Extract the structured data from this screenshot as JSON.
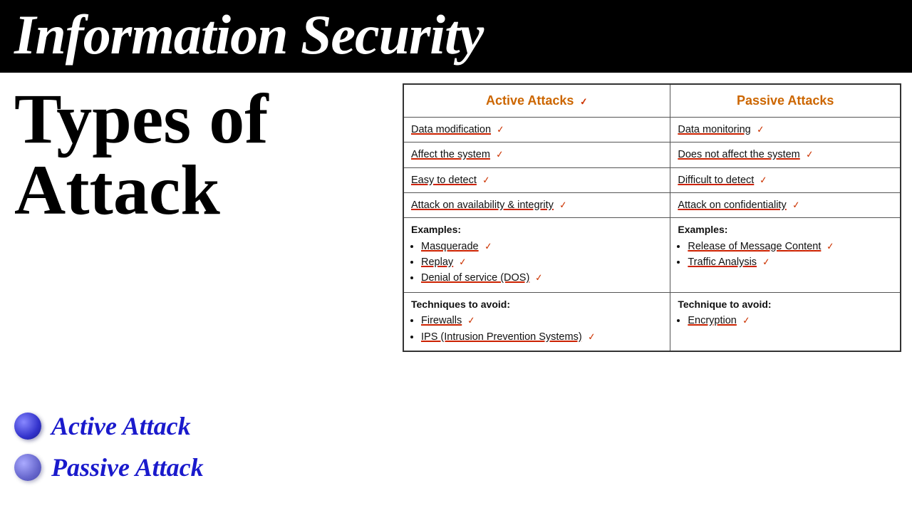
{
  "header": {
    "title": "Information Security"
  },
  "left": {
    "types_title": "Types of Attack",
    "attack_items": [
      {
        "id": "active",
        "label": "Active Attack",
        "sphere_class": "active"
      },
      {
        "id": "passive",
        "label": "Passive Attack",
        "sphere_class": "passive"
      }
    ]
  },
  "table": {
    "columns": [
      "Active Attacks",
      "Passive Attacks"
    ],
    "rows": [
      {
        "active": "Data modification",
        "passive": "Data monitoring"
      },
      {
        "active": "Affect the system",
        "passive": "Does not affect the system"
      },
      {
        "active": "Easy to detect",
        "passive": "Difficult to detect"
      },
      {
        "active": "Attack on availability & integrity",
        "passive": "Attack on confidentiality"
      }
    ],
    "examples": {
      "active_label": "Examples:",
      "active_items": [
        "Masquerade",
        "Replay",
        "Denial of service (DOS)"
      ],
      "passive_label": "Examples:",
      "passive_items": [
        "Release of Message Content",
        "Traffic Analysis"
      ]
    },
    "techniques": {
      "active_label": "Techniques to avoid:",
      "active_items": [
        "Firewalls",
        "IPS (Intrusion Prevention Systems)"
      ],
      "passive_label": "Technique to avoid:",
      "passive_items": [
        "Encryption"
      ]
    }
  }
}
